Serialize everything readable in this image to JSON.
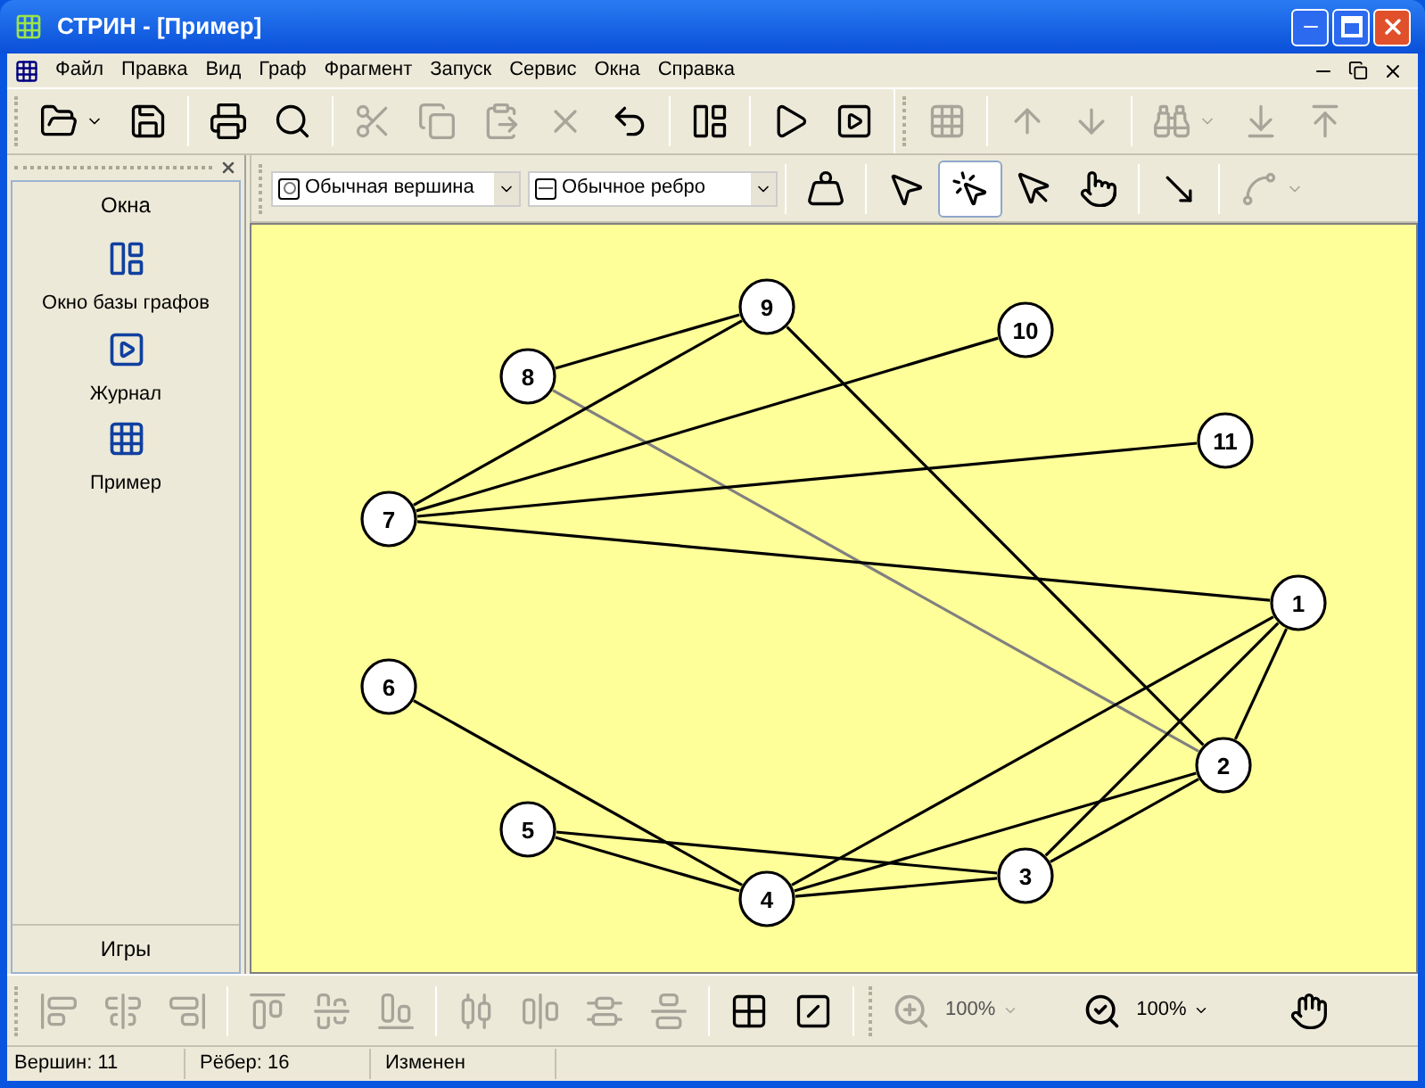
{
  "window": {
    "title": "СТРИН - [Пример]"
  },
  "menu": [
    "Файл",
    "Правка",
    "Вид",
    "Граф",
    "Фрагмент",
    "Запуск",
    "Сервис",
    "Окна",
    "Справка"
  ],
  "main_toolbar": [
    {
      "disabled": false
    },
    {
      "disabled": false
    },
    {
      "disabled": false
    },
    {
      "disabled": false
    },
    {
      "disabled": true
    },
    {
      "disabled": true
    },
    {
      "disabled": true
    },
    {
      "disabled": true
    },
    {
      "disabled": false
    },
    {
      "disabled": false
    },
    {
      "disabled": false
    },
    {
      "disabled": false
    },
    {
      "disabled": true
    },
    {
      "disabled": true
    },
    {
      "disabled": true
    },
    {
      "disabled": true
    },
    {
      "disabled": true
    },
    {
      "disabled": true
    }
  ],
  "graph_toolbar": {
    "vertex_type": "Обычная вершина",
    "edge_type": "Обычное ребро",
    "tools": [
      {
        "selected": false
      },
      {
        "selected": true
      },
      {
        "selected": false
      },
      {
        "selected": false
      },
      {
        "selected": false
      },
      {
        "selected": false
      }
    ]
  },
  "side_panel": {
    "title": "Окна",
    "items": [
      {
        "label": "Окно базы графов"
      },
      {
        "label": "Журнал"
      },
      {
        "label": "Пример"
      }
    ],
    "footer": "Игры"
  },
  "graph": {
    "vertices": [
      "1",
      "2",
      "3",
      "4",
      "5",
      "6",
      "7",
      "8",
      "9",
      "10",
      "11"
    ],
    "edges": [
      {
        "selected": false
      },
      {
        "selected": true
      },
      {
        "selected": false
      },
      {
        "selected": false
      },
      {
        "selected": false
      },
      {
        "selected": false
      },
      {
        "selected": false
      },
      {
        "selected": false
      },
      {
        "selected": false
      },
      {
        "selected": false
      },
      {
        "selected": false
      },
      {
        "selected": false
      },
      {
        "selected": false
      },
      {
        "selected": false
      },
      {
        "selected": false
      },
      {
        "selected": false
      }
    ]
  },
  "bottom_toolbar": {
    "align": [
      {
        "disabled": true
      },
      {
        "disabled": true
      },
      {
        "disabled": true
      },
      {
        "disabled": true
      },
      {
        "disabled": true
      },
      {
        "disabled": true
      },
      {
        "disabled": true
      },
      {
        "disabled": true
      },
      {
        "disabled": true
      },
      {
        "disabled": true
      }
    ],
    "grid": [
      {
        "disabled": false
      },
      {
        "disabled": false
      }
    ],
    "zoom": [
      {
        "value": "100%",
        "disabled": true
      },
      {
        "value": "100%",
        "disabled": false
      }
    ]
  },
  "status_bar": [
    "Вершин: 11",
    "Рёбер: 16",
    "Изменен"
  ]
}
